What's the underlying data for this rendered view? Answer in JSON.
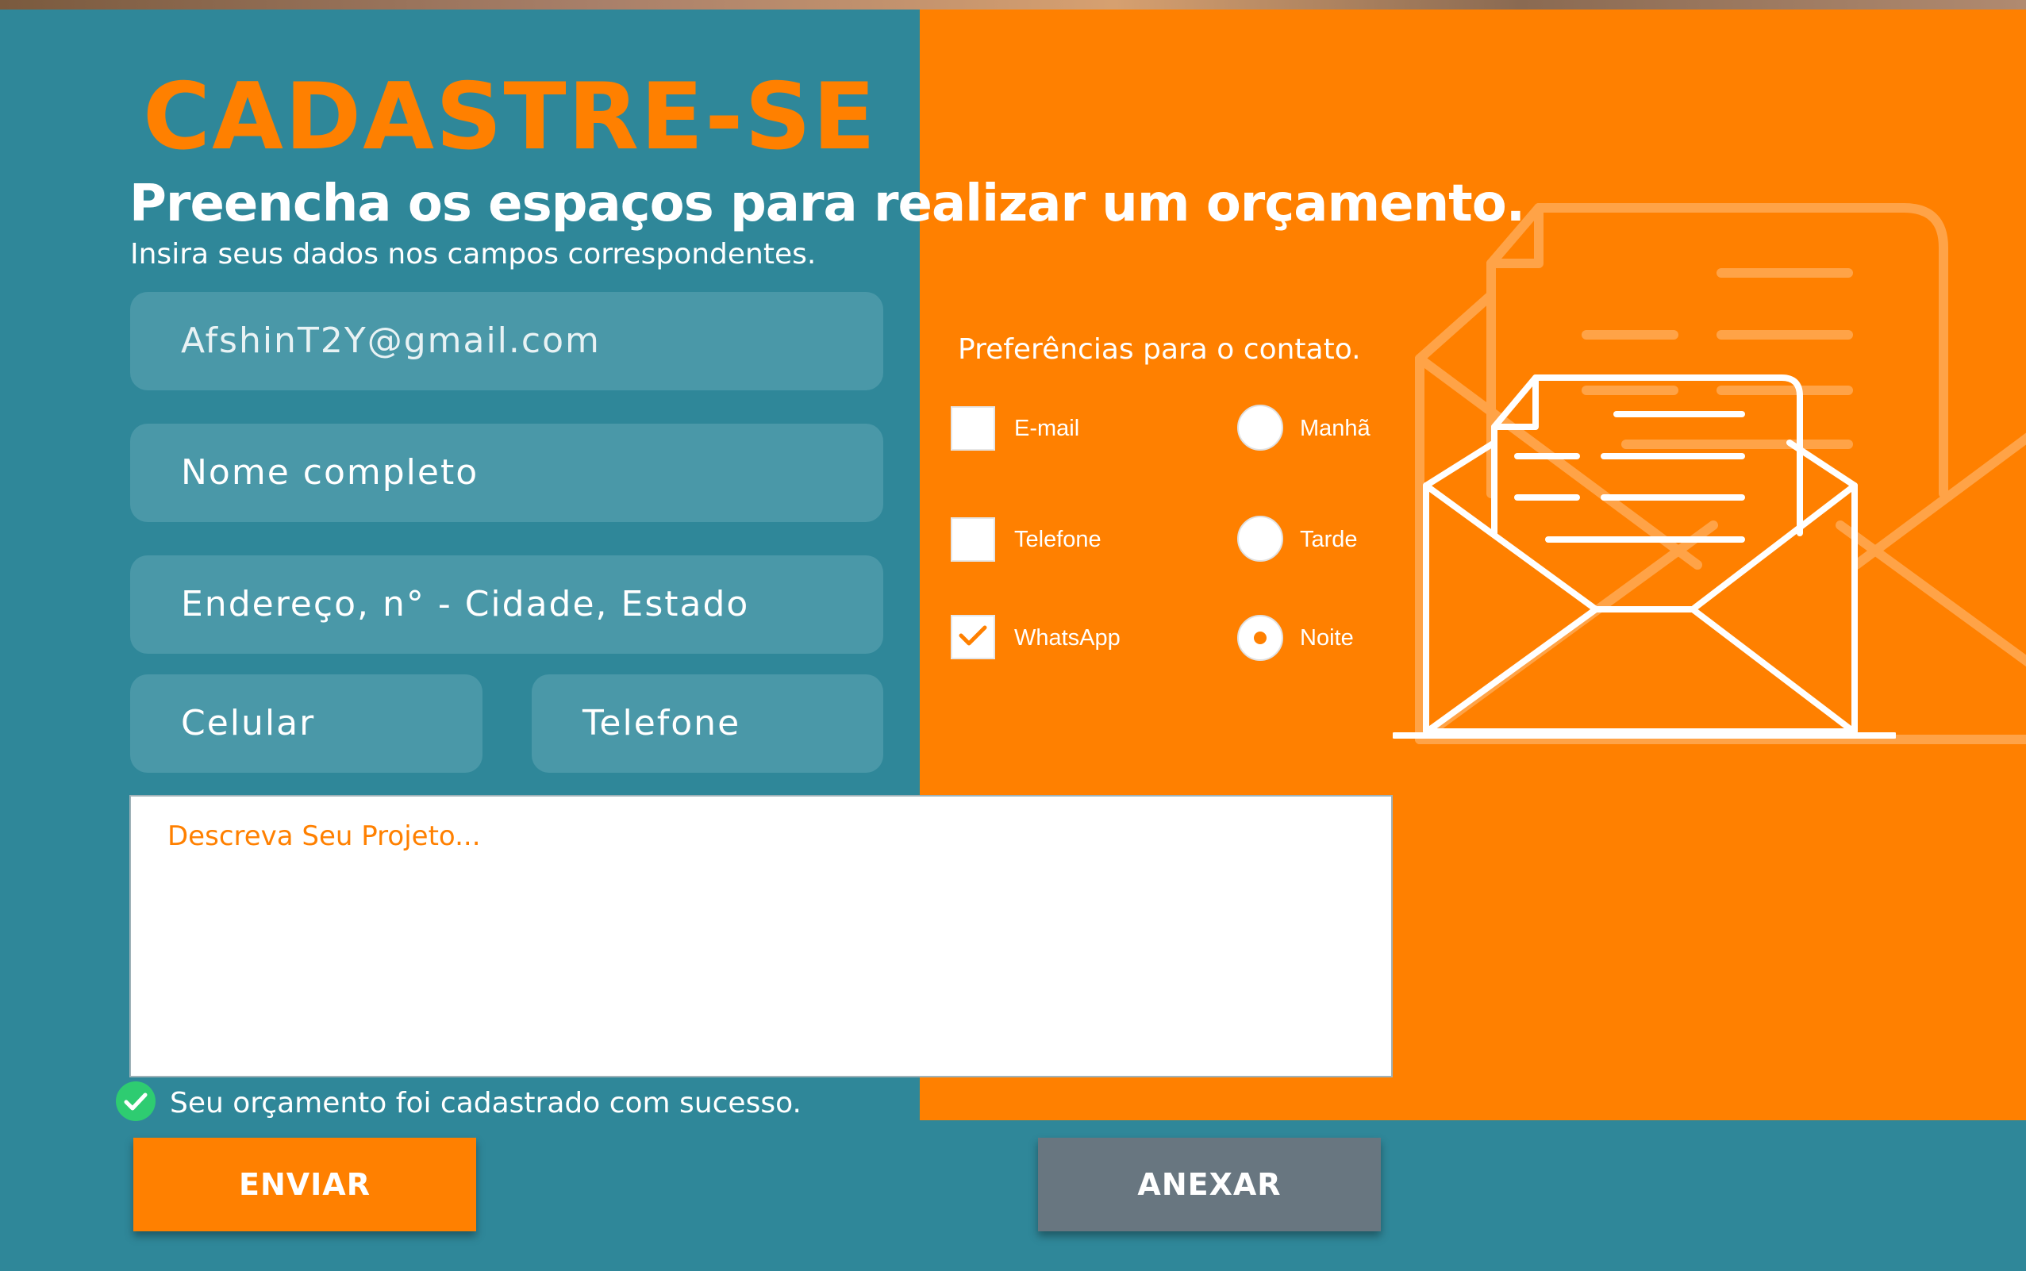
{
  "header": {
    "title": "CADASTRE-SE",
    "subtitle": "Preencha os espaços para realizar um orçamento.",
    "hint": "Insira seus dados nos campos correspondentes."
  },
  "form": {
    "email_value": "AfshinT2Y@gmail.com",
    "name_placeholder": "Nome completo",
    "address_placeholder": "Endereço, n° - Cidade, Estado",
    "cell_placeholder": "Celular",
    "phone_placeholder": "Telefone",
    "description_placeholder": "Descreva Seu Projeto..."
  },
  "preferences": {
    "title": "Preferências  para o contato.",
    "channels": [
      {
        "label": "E-mail",
        "checked": false
      },
      {
        "label": "Telefone",
        "checked": false
      },
      {
        "label": "WhatsApp",
        "checked": true
      }
    ],
    "periods": [
      {
        "label": "Manhã",
        "selected": false
      },
      {
        "label": "Tarde",
        "selected": false
      },
      {
        "label": "Noite",
        "selected": true
      }
    ]
  },
  "status": {
    "success_message": "Seu orçamento foi cadastrado com sucesso."
  },
  "actions": {
    "send_label": "ENVIAR",
    "attach_label": "ANEXAR"
  },
  "colors": {
    "brand_orange": "#ff8000",
    "teal_background": "#2f8799",
    "field_background": "#4a98a8",
    "success_green": "#2ecc71",
    "attach_gray": "#687680"
  },
  "icons": {
    "envelope": "open-envelope-icon",
    "success": "check-circle-icon",
    "checkbox_checked": "check-icon"
  }
}
